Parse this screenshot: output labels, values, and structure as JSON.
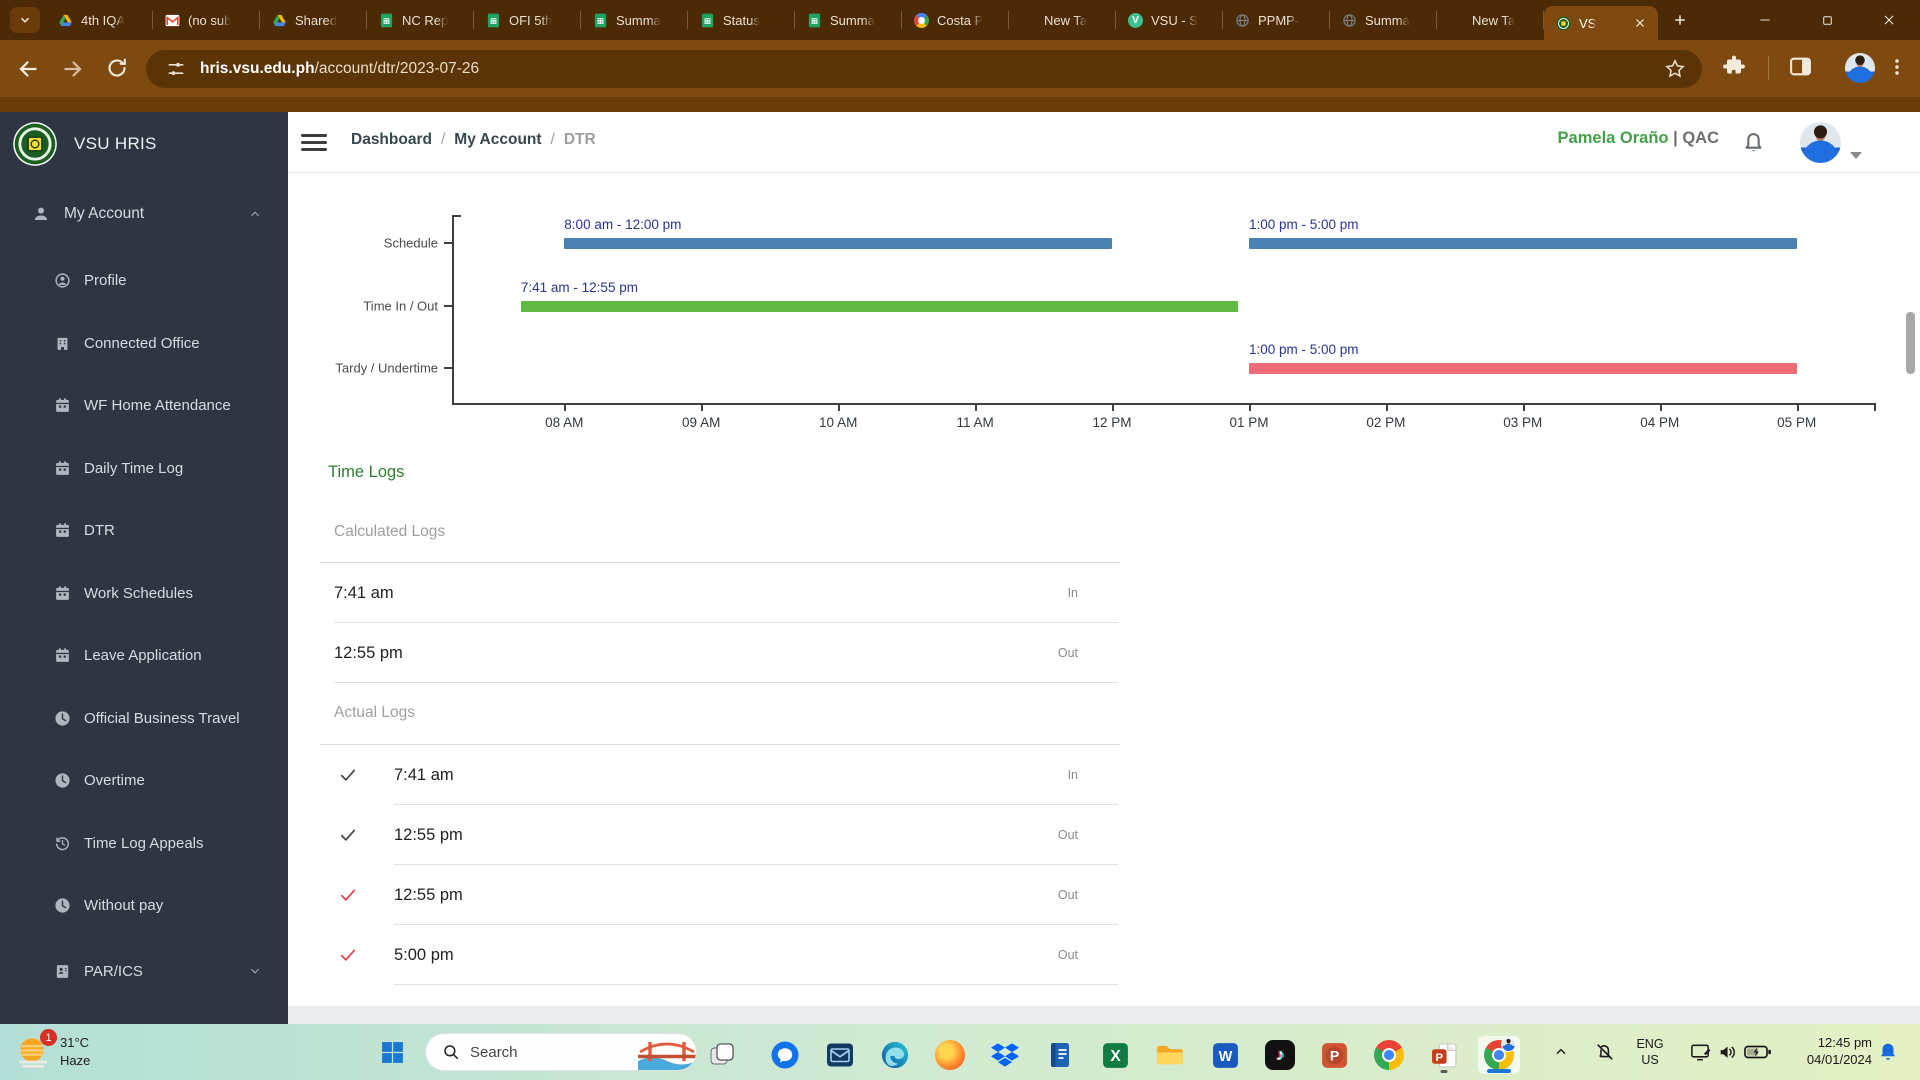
{
  "browser": {
    "tabs": [
      {
        "label": "4th IQA",
        "icon": "drive-icon"
      },
      {
        "label": "(no sub",
        "icon": "gmail-icon"
      },
      {
        "label": "Shared",
        "icon": "drive-icon"
      },
      {
        "label": "NC Rep",
        "icon": "sheets-icon"
      },
      {
        "label": "OFI 5th",
        "icon": "sheets-icon"
      },
      {
        "label": "Summa",
        "icon": "sheets-icon"
      },
      {
        "label": "Status",
        "icon": "sheets-icon"
      },
      {
        "label": "Summa",
        "icon": "sheets-icon"
      },
      {
        "label": "Costa P",
        "icon": "google-icon"
      },
      {
        "label": "New Ta",
        "icon": "chrome-grey-icon"
      },
      {
        "label": "VSU - S",
        "icon": "vsu-v-icon"
      },
      {
        "label": "PPMP-",
        "icon": "globe-icon"
      },
      {
        "label": "Summa",
        "icon": "globe-icon"
      },
      {
        "label": "New Ta",
        "icon": "chrome-grey-icon"
      },
      {
        "label": "VS",
        "icon": "vsu-seal-icon",
        "active": true
      }
    ],
    "url_host": "hris.vsu.edu.ph",
    "url_path": "/account/dtr/2023-07-26"
  },
  "sidebar": {
    "brand": "VSU HRIS",
    "root_item": {
      "label": "My Account",
      "icon": "user-icon",
      "expanded": true
    },
    "items": [
      {
        "label": "Profile",
        "icon": "user-circle-icon"
      },
      {
        "label": "Connected Office",
        "icon": "building-icon"
      },
      {
        "label": "WF Home Attendance",
        "icon": "calendar-icon"
      },
      {
        "label": "Daily Time Log",
        "icon": "calendar-icon"
      },
      {
        "label": "DTR",
        "icon": "calendar-icon"
      },
      {
        "label": "Work Schedules",
        "icon": "calendar-icon"
      },
      {
        "label": "Leave Application",
        "icon": "calendar-icon"
      },
      {
        "label": "Official Business Travel",
        "icon": "clock-icon"
      },
      {
        "label": "Overtime",
        "icon": "clock-icon"
      },
      {
        "label": "Time Log Appeals",
        "icon": "history-icon"
      },
      {
        "label": "Without pay",
        "icon": "clock-icon"
      },
      {
        "label": "PAR/ICS",
        "icon": "id-card-icon",
        "expandable": true
      }
    ]
  },
  "header": {
    "breadcrumb": [
      "Dashboard",
      "My Account",
      "DTR"
    ],
    "breadcrumb_separator": "/",
    "user_name": "Pamela Oraño",
    "user_separator": "|",
    "user_unit": "QAC"
  },
  "chart_data": {
    "type": "bar",
    "subtype": "gantt-timeline",
    "categories": [
      "Schedule",
      "Time In / Out",
      "Tardy / Undertime"
    ],
    "x_ticks": [
      "08 AM",
      "09 AM",
      "10 AM",
      "11 AM",
      "12 PM",
      "01 PM",
      "02 PM",
      "03 PM",
      "04 PM",
      "05 PM"
    ],
    "x_tick_hours": [
      8,
      9,
      10,
      11,
      12,
      13,
      14,
      15,
      16,
      17
    ],
    "x_range_hours": [
      7.18,
      17.55
    ],
    "grid": false,
    "series": [
      {
        "name": "Schedule",
        "color": "#4a80b2",
        "bars": [
          {
            "start_hour": 8.0,
            "end_hour": 12.0,
            "label": "8:00 am - 12:00 pm"
          },
          {
            "start_hour": 13.0,
            "end_hour": 17.0,
            "label": "1:00 pm - 5:00 pm"
          }
        ]
      },
      {
        "name": "Time In / Out",
        "color": "#61b843",
        "bars": [
          {
            "start_hour": 7.683,
            "end_hour": 12.917,
            "label": "7:41 am - 12:55 pm"
          }
        ]
      },
      {
        "name": "Tardy / Undertime",
        "color": "#ee6b78",
        "bars": [
          {
            "start_hour": 13.0,
            "end_hour": 17.0,
            "label": "1:00 pm - 5:00 pm"
          }
        ]
      }
    ],
    "label_color": "#283593"
  },
  "time_logs": {
    "title": "Time Logs",
    "sections": [
      {
        "title": "Calculated Logs",
        "rows": [
          {
            "time": "7:41 am",
            "direction": "In"
          },
          {
            "time": "12:55 pm",
            "direction": "Out"
          }
        ]
      },
      {
        "title": "Actual Logs",
        "rows": [
          {
            "time": "7:41 am",
            "direction": "In",
            "check": "dark"
          },
          {
            "time": "12:55 pm",
            "direction": "Out",
            "check": "dark"
          },
          {
            "time": "12:55 pm",
            "direction": "Out",
            "check": "red"
          },
          {
            "time": "5:00 pm",
            "direction": "Out",
            "check": "red"
          }
        ]
      }
    ]
  },
  "taskbar": {
    "weather": {
      "temp": "31°C",
      "condition": "Haze",
      "badge": "1"
    },
    "search_placeholder": "Search",
    "apps": [
      {
        "name": "task-view-icon"
      },
      {
        "name": "chat-icon"
      },
      {
        "name": "mail-icon"
      },
      {
        "name": "edge-icon"
      },
      {
        "name": "firefox-icon"
      },
      {
        "name": "dropbox-icon"
      },
      {
        "name": "book-icon"
      },
      {
        "name": "excel-icon"
      },
      {
        "name": "folder-icon"
      },
      {
        "name": "word-icon"
      },
      {
        "name": "tiktok-icon"
      },
      {
        "name": "powerpoint-icon"
      },
      {
        "name": "chrome-icon"
      },
      {
        "name": "powerpoint-file-icon",
        "running": true
      },
      {
        "name": "chrome-profile-icon",
        "active": true
      }
    ],
    "tray": {
      "language_line1": "ENG",
      "language_line2": "US",
      "time": "12:45 pm",
      "date": "04/01/2024"
    }
  },
  "colors": {
    "accent_green": "#43a047",
    "chart_blue": "#4a80b2",
    "chart_green": "#61b843",
    "chart_red": "#ee6b78",
    "sidebar_bg": "#2f3542",
    "browser_frame": "#7f4a10"
  }
}
